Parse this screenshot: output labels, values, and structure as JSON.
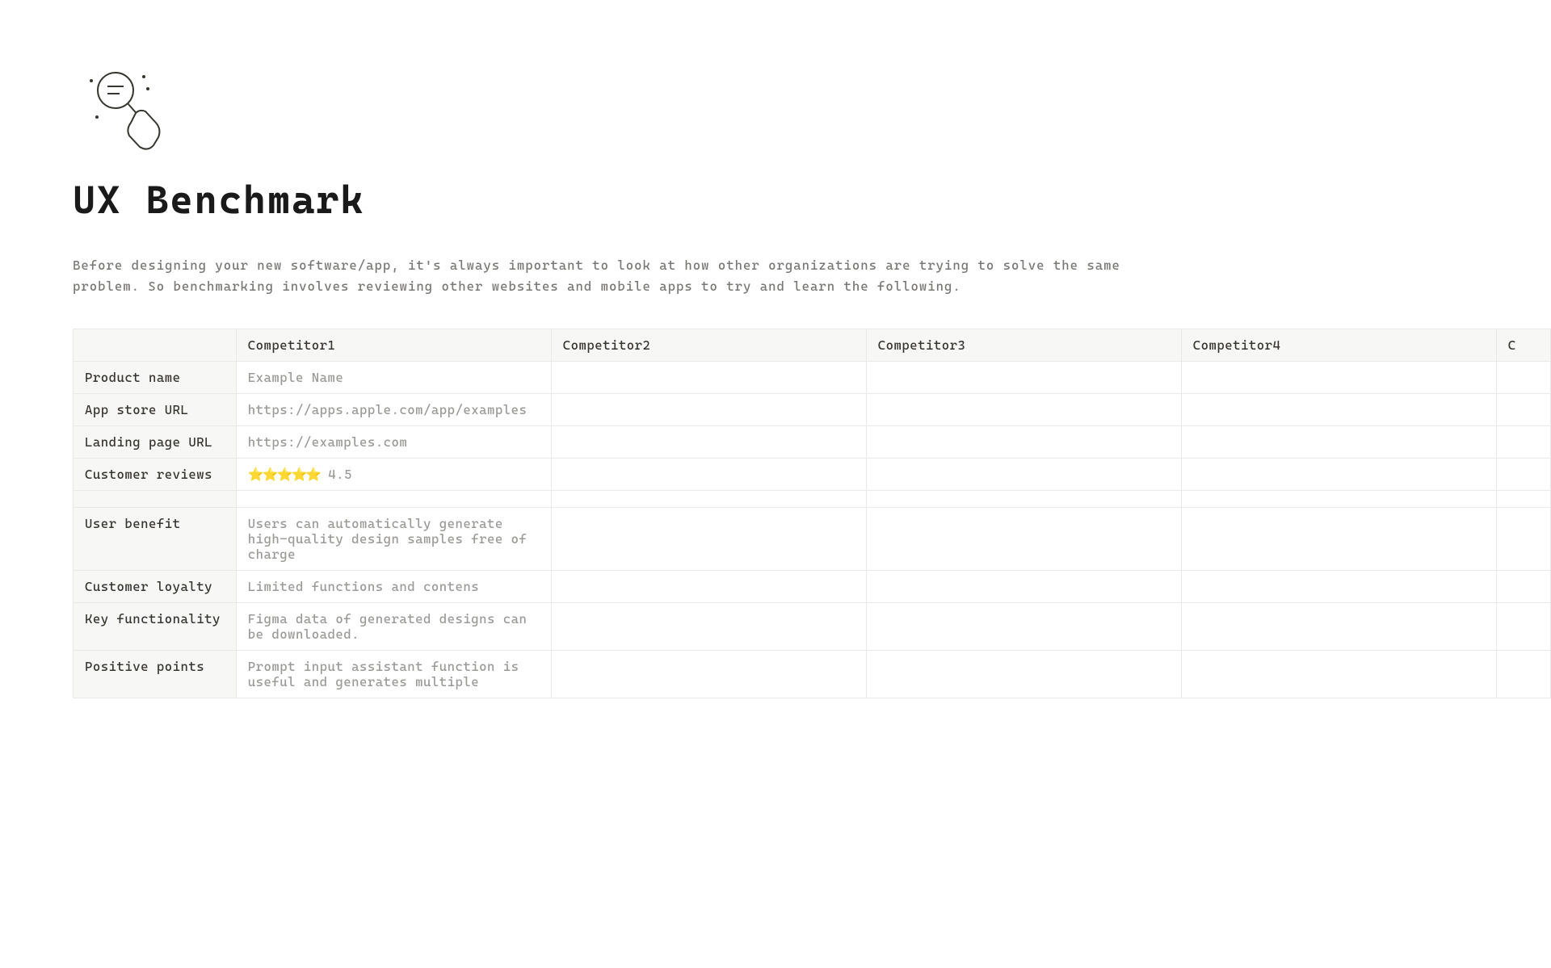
{
  "page": {
    "title": "UX Benchmark",
    "description": "Before designing your new software/app, it's always important to look at how other organizations are trying to solve the same problem. So benchmarking involves reviewing other websites and mobile apps to try and learn the following."
  },
  "table": {
    "headers": {
      "blank": "",
      "competitor1": "Competitor1",
      "competitor2": "Competitor2",
      "competitor3": "Competitor3",
      "competitor4": "Competitor4",
      "competitor5_partial": "C"
    },
    "rows": {
      "product_name": {
        "label": "Product name",
        "c1": "Example Name",
        "c2": "",
        "c3": "",
        "c4": ""
      },
      "app_store_url": {
        "label": "App store URL",
        "c1": "https://apps.apple.com/app/examples",
        "c2": "",
        "c3": "",
        "c4": ""
      },
      "landing_page_url": {
        "label": "Landing page URL",
        "c1": "https://examples.com",
        "c2": "",
        "c3": "",
        "c4": ""
      },
      "customer_reviews": {
        "label": "Customer reviews",
        "c1_stars": "⭐⭐⭐⭐⭐",
        "c1_rating": " 4.5",
        "c2": "",
        "c3": "",
        "c4": ""
      },
      "blank_row": {
        "label": "",
        "c1": "",
        "c2": "",
        "c3": "",
        "c4": ""
      },
      "user_benefit": {
        "label": "User benefit",
        "c1": "Users can automatically generate high-quality design samples free of charge",
        "c2": "",
        "c3": "",
        "c4": ""
      },
      "customer_loyalty": {
        "label": "Customer loyalty",
        "c1": "Limited functions and contens",
        "c2": "",
        "c3": "",
        "c4": ""
      },
      "key_functionality": {
        "label": "Key functionality",
        "c1": "Figma data of generated designs can be downloaded.",
        "c2": "",
        "c3": "",
        "c4": ""
      },
      "positive_points": {
        "label": "Positive points",
        "c1": "Prompt input assistant function is useful and generates multiple",
        "c2": "",
        "c3": "",
        "c4": ""
      }
    }
  }
}
